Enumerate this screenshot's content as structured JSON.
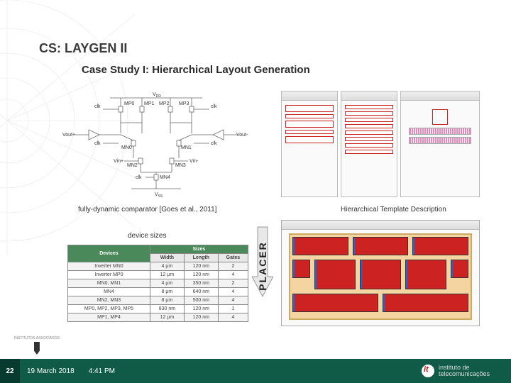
{
  "title": "CS: LAYGEN II",
  "subtitle": "Case Study I: Hierarchical Layout Generation",
  "schematic": {
    "labels": {
      "vdd": "V",
      "vdd_sub": "DD",
      "vss": "V",
      "vss_sub": "SS",
      "clk": "clk",
      "voutp": "Vout+",
      "voutm": "Vout-",
      "vinp": "Vin+",
      "vinm": "Vin-",
      "mp0": "MP0",
      "mp1": "MP1",
      "mp2": "MP2",
      "mp3": "MP3",
      "mn0": "MN0",
      "mn1": "MN1",
      "mn2": "MN2",
      "mn3": "MN3",
      "mn4": "MN4"
    }
  },
  "captions": {
    "comparator": "fully-dynamic comparator [Goes et al., 2011]",
    "template": "Hierarchical Template Description",
    "device_sizes": "device sizes",
    "placer": "PLACER"
  },
  "device_table": {
    "header_group": [
      "Devices",
      "Sizes"
    ],
    "columns": [
      "Width",
      "Length",
      "Gates"
    ],
    "rows": [
      {
        "dev": "Inverter MN0",
        "w": "4 μm",
        "l": "120 nm",
        "g": "2"
      },
      {
        "dev": "Inverter MP0",
        "w": "12 μm",
        "l": "120 nm",
        "g": "4"
      },
      {
        "dev": "MN0, MN1",
        "w": "4 μm",
        "l": "350 nm",
        "g": "2"
      },
      {
        "dev": "MN4",
        "w": "8 μm",
        "l": "640 nm",
        "g": "4"
      },
      {
        "dev": "MN2, MN3",
        "w": "8 μm",
        "l": "500 nm",
        "g": "4"
      },
      {
        "dev": "MP0, MP2, MP3, MP5",
        "w": "830 nm",
        "l": "120 nm",
        "g": "1"
      },
      {
        "dev": "MP1, MP4",
        "w": "12 μm",
        "l": "120 nm",
        "g": "4"
      }
    ]
  },
  "footer": {
    "page": "22",
    "date": "19 March 2018",
    "time": "4:41 PM",
    "inst": "instituto de telecomunicações",
    "assoc": "INSTITUTOS ASSOCIADOS"
  }
}
